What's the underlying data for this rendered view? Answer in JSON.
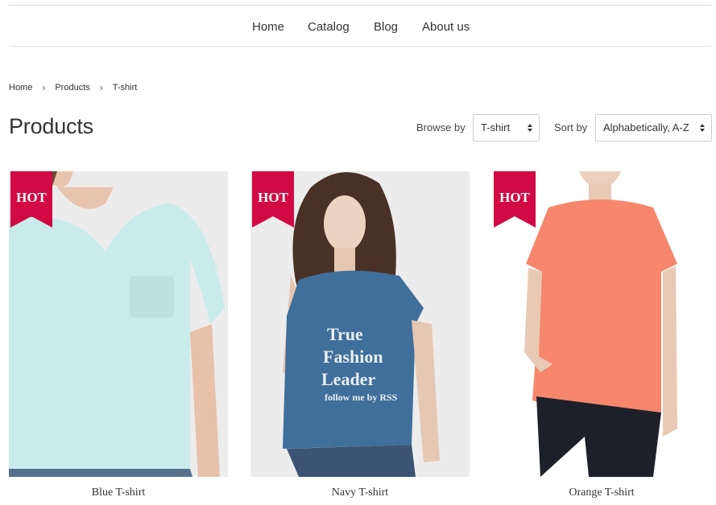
{
  "nav": {
    "items": [
      {
        "label": "Home"
      },
      {
        "label": "Catalog"
      },
      {
        "label": "Blog"
      },
      {
        "label": "About us"
      }
    ]
  },
  "breadcrumb": {
    "items": [
      "Home",
      "Products",
      "T-shirt"
    ],
    "separator": "›"
  },
  "page": {
    "title": "Products"
  },
  "filters": {
    "browse_label": "Browse by",
    "browse_value": "T-shirt",
    "sort_label": "Sort by",
    "sort_value": "Alphabetically, A-Z"
  },
  "products": [
    {
      "title": "Blue T-shirt",
      "badge": "HOT",
      "shirt_color": "#c9ecea",
      "shirt_print": ""
    },
    {
      "title": "Navy T-shirt",
      "badge": "HOT",
      "shirt_color": "#3f6f9a",
      "shirt_print": "True Fashion Leader follow me by RSS"
    },
    {
      "title": "Orange T-shirt",
      "badge": "HOT",
      "shirt_color": "#f6876c",
      "shirt_print": ""
    }
  ],
  "colors": {
    "badge": "#d10a45",
    "border": "#dcdcdc",
    "text": "#333333"
  }
}
